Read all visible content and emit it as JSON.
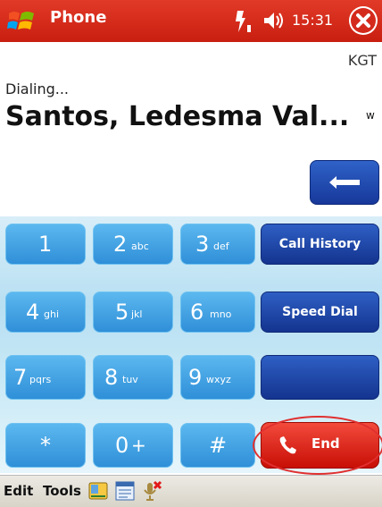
{
  "titlebar": {
    "app_title": "Phone",
    "time": "15:31"
  },
  "call": {
    "operator": "KGT",
    "status": "Dialing...",
    "contact_name": "Santos, Ledesma Val...",
    "contact_suffix": "w"
  },
  "keypad": {
    "keys": [
      {
        "digit": "1",
        "letters": ""
      },
      {
        "digit": "2",
        "letters": "abc"
      },
      {
        "digit": "3",
        "letters": "def"
      },
      {
        "digit": "4",
        "letters": "ghi"
      },
      {
        "digit": "5",
        "letters": "jkl"
      },
      {
        "digit": "6",
        "letters": "mno"
      },
      {
        "digit": "7",
        "letters": "pqrs"
      },
      {
        "digit": "8",
        "letters": "tuv"
      },
      {
        "digit": "9",
        "letters": "wxyz"
      },
      {
        "digit": "*",
        "letters": ""
      },
      {
        "digit": "0",
        "letters": "+"
      },
      {
        "digit": "#",
        "letters": ""
      }
    ],
    "call_history": "Call History",
    "speed_dial": "Speed Dial",
    "end": "End"
  },
  "menubar": {
    "edit": "Edit",
    "tools": "Tools"
  },
  "colors": {
    "titlebar": "#d62a1a",
    "key": "#3b9fe0",
    "function_key": "#1e45a8",
    "end_key": "#e0261a"
  }
}
